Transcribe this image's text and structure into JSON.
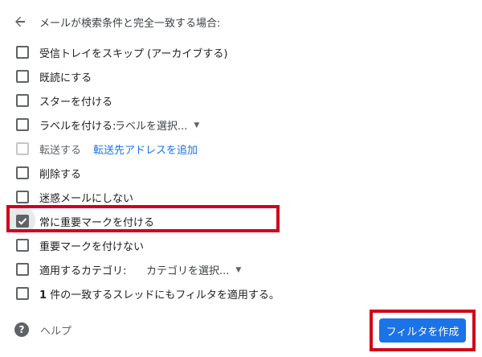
{
  "header": {
    "title": "メールが検索条件と完全一致する場合:"
  },
  "options": [
    {
      "label": "受信トレイをスキップ (アーカイブする)",
      "checked": false
    },
    {
      "label": "既読にする",
      "checked": false
    },
    {
      "label": "スターを付ける",
      "checked": false
    },
    {
      "label": "ラベルを付ける:",
      "checked": false,
      "select_value": "ラベルを選択..."
    },
    {
      "label": "転送する",
      "checked": false,
      "disabled": true,
      "link": "転送先アドレスを追加"
    },
    {
      "label": "削除する",
      "checked": false
    },
    {
      "label": "迷惑メールにしない",
      "checked": false
    },
    {
      "label": "常に重要マークを付ける",
      "checked": true
    },
    {
      "label": "重要マークを付けない",
      "checked": false
    },
    {
      "label": "適用するカテゴリ:",
      "checked": false,
      "select_value": "カテゴリを選択..."
    },
    {
      "label_count": "1",
      "label": "件の一致するスレッドにもフィルタを適用する。",
      "checked": false
    }
  ],
  "footer": {
    "help_label": "ヘルプ",
    "create_button": "フィルタを作成"
  },
  "colors": {
    "primary": "#1a73e8",
    "highlight": "#d0021b",
    "checkbox": "#5f6368"
  }
}
